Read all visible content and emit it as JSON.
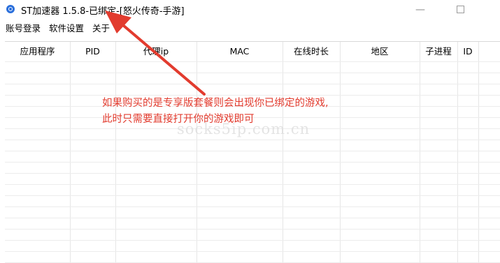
{
  "window": {
    "title": "ST加速器 1.5.8-已绑定-[怒火传奇-手游]",
    "minimize_glyph": "—"
  },
  "menu": {
    "items": [
      "账号登录",
      "软件设置",
      "关于"
    ]
  },
  "table": {
    "columns": [
      "应用程序",
      "PID",
      "代理ip",
      "MAC",
      "在线时长",
      "地区",
      "子进程",
      "ID"
    ],
    "rows": []
  },
  "annotation": {
    "line1": "如果购买的是专享版套餐则会出现你已绑定的游戏,",
    "line2": "此时只需要直接打开你的游戏即可",
    "color": "#e23b2e"
  },
  "watermark": "socks5ip.com.cn"
}
